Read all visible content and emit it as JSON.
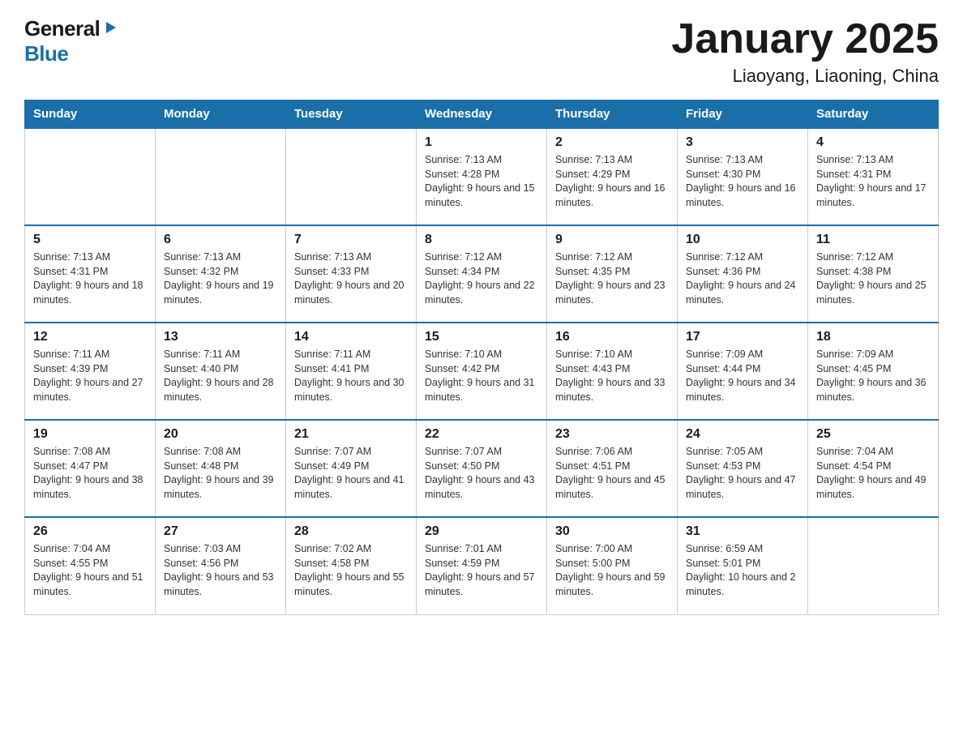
{
  "logo": {
    "general": "General",
    "blue": "Blue",
    "triangle": "▶"
  },
  "title": "January 2025",
  "subtitle": "Liaoyang, Liaoning, China",
  "days_of_week": [
    "Sunday",
    "Monday",
    "Tuesday",
    "Wednesday",
    "Thursday",
    "Friday",
    "Saturday"
  ],
  "weeks": [
    [
      {
        "day": "",
        "info": ""
      },
      {
        "day": "",
        "info": ""
      },
      {
        "day": "",
        "info": ""
      },
      {
        "day": "1",
        "info": "Sunrise: 7:13 AM\nSunset: 4:28 PM\nDaylight: 9 hours\nand 15 minutes."
      },
      {
        "day": "2",
        "info": "Sunrise: 7:13 AM\nSunset: 4:29 PM\nDaylight: 9 hours\nand 16 minutes."
      },
      {
        "day": "3",
        "info": "Sunrise: 7:13 AM\nSunset: 4:30 PM\nDaylight: 9 hours\nand 16 minutes."
      },
      {
        "day": "4",
        "info": "Sunrise: 7:13 AM\nSunset: 4:31 PM\nDaylight: 9 hours\nand 17 minutes."
      }
    ],
    [
      {
        "day": "5",
        "info": "Sunrise: 7:13 AM\nSunset: 4:31 PM\nDaylight: 9 hours\nand 18 minutes."
      },
      {
        "day": "6",
        "info": "Sunrise: 7:13 AM\nSunset: 4:32 PM\nDaylight: 9 hours\nand 19 minutes."
      },
      {
        "day": "7",
        "info": "Sunrise: 7:13 AM\nSunset: 4:33 PM\nDaylight: 9 hours\nand 20 minutes."
      },
      {
        "day": "8",
        "info": "Sunrise: 7:12 AM\nSunset: 4:34 PM\nDaylight: 9 hours\nand 22 minutes."
      },
      {
        "day": "9",
        "info": "Sunrise: 7:12 AM\nSunset: 4:35 PM\nDaylight: 9 hours\nand 23 minutes."
      },
      {
        "day": "10",
        "info": "Sunrise: 7:12 AM\nSunset: 4:36 PM\nDaylight: 9 hours\nand 24 minutes."
      },
      {
        "day": "11",
        "info": "Sunrise: 7:12 AM\nSunset: 4:38 PM\nDaylight: 9 hours\nand 25 minutes."
      }
    ],
    [
      {
        "day": "12",
        "info": "Sunrise: 7:11 AM\nSunset: 4:39 PM\nDaylight: 9 hours\nand 27 minutes."
      },
      {
        "day": "13",
        "info": "Sunrise: 7:11 AM\nSunset: 4:40 PM\nDaylight: 9 hours\nand 28 minutes."
      },
      {
        "day": "14",
        "info": "Sunrise: 7:11 AM\nSunset: 4:41 PM\nDaylight: 9 hours\nand 30 minutes."
      },
      {
        "day": "15",
        "info": "Sunrise: 7:10 AM\nSunset: 4:42 PM\nDaylight: 9 hours\nand 31 minutes."
      },
      {
        "day": "16",
        "info": "Sunrise: 7:10 AM\nSunset: 4:43 PM\nDaylight: 9 hours\nand 33 minutes."
      },
      {
        "day": "17",
        "info": "Sunrise: 7:09 AM\nSunset: 4:44 PM\nDaylight: 9 hours\nand 34 minutes."
      },
      {
        "day": "18",
        "info": "Sunrise: 7:09 AM\nSunset: 4:45 PM\nDaylight: 9 hours\nand 36 minutes."
      }
    ],
    [
      {
        "day": "19",
        "info": "Sunrise: 7:08 AM\nSunset: 4:47 PM\nDaylight: 9 hours\nand 38 minutes."
      },
      {
        "day": "20",
        "info": "Sunrise: 7:08 AM\nSunset: 4:48 PM\nDaylight: 9 hours\nand 39 minutes."
      },
      {
        "day": "21",
        "info": "Sunrise: 7:07 AM\nSunset: 4:49 PM\nDaylight: 9 hours\nand 41 minutes."
      },
      {
        "day": "22",
        "info": "Sunrise: 7:07 AM\nSunset: 4:50 PM\nDaylight: 9 hours\nand 43 minutes."
      },
      {
        "day": "23",
        "info": "Sunrise: 7:06 AM\nSunset: 4:51 PM\nDaylight: 9 hours\nand 45 minutes."
      },
      {
        "day": "24",
        "info": "Sunrise: 7:05 AM\nSunset: 4:53 PM\nDaylight: 9 hours\nand 47 minutes."
      },
      {
        "day": "25",
        "info": "Sunrise: 7:04 AM\nSunset: 4:54 PM\nDaylight: 9 hours\nand 49 minutes."
      }
    ],
    [
      {
        "day": "26",
        "info": "Sunrise: 7:04 AM\nSunset: 4:55 PM\nDaylight: 9 hours\nand 51 minutes."
      },
      {
        "day": "27",
        "info": "Sunrise: 7:03 AM\nSunset: 4:56 PM\nDaylight: 9 hours\nand 53 minutes."
      },
      {
        "day": "28",
        "info": "Sunrise: 7:02 AM\nSunset: 4:58 PM\nDaylight: 9 hours\nand 55 minutes."
      },
      {
        "day": "29",
        "info": "Sunrise: 7:01 AM\nSunset: 4:59 PM\nDaylight: 9 hours\nand 57 minutes."
      },
      {
        "day": "30",
        "info": "Sunrise: 7:00 AM\nSunset: 5:00 PM\nDaylight: 9 hours\nand 59 minutes."
      },
      {
        "day": "31",
        "info": "Sunrise: 6:59 AM\nSunset: 5:01 PM\nDaylight: 10 hours\nand 2 minutes."
      },
      {
        "day": "",
        "info": ""
      }
    ]
  ]
}
